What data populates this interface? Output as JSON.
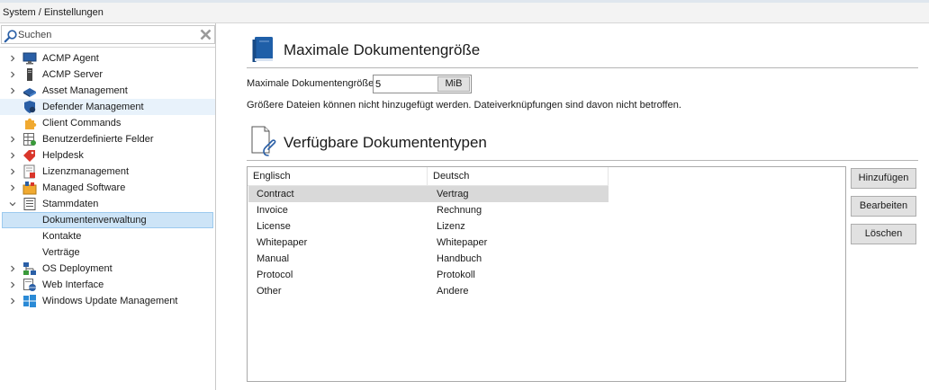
{
  "breadcrumb": "System / Einstellungen",
  "search": {
    "placeholder": "Suchen",
    "value": ""
  },
  "tree": [
    {
      "label": "ACMP Agent",
      "icon": "monitor-icon",
      "expander": "collapsed"
    },
    {
      "label": "ACMP Server",
      "icon": "server-icon",
      "expander": "collapsed"
    },
    {
      "label": "Asset Management",
      "icon": "asset-icon",
      "expander": "collapsed"
    },
    {
      "label": "Defender Management",
      "icon": "shield-icon",
      "expander": "none",
      "state": "hover"
    },
    {
      "label": "Client Commands",
      "icon": "puzzle-icon",
      "expander": "none"
    },
    {
      "label": "Benutzerdefinierte Felder",
      "icon": "grid-icon",
      "expander": "collapsed"
    },
    {
      "label": "Helpdesk",
      "icon": "tag-icon",
      "expander": "collapsed"
    },
    {
      "label": "Lizenzmanagement",
      "icon": "license-icon",
      "expander": "collapsed"
    },
    {
      "label": "Managed Software",
      "icon": "package-icon",
      "expander": "collapsed"
    },
    {
      "label": "Stammdaten",
      "icon": "list-icon",
      "expander": "expanded"
    },
    {
      "label": "Dokumentenverwaltung",
      "icon": "",
      "expander": "none",
      "state": "selected",
      "child": true
    },
    {
      "label": "Kontakte",
      "icon": "",
      "expander": "none",
      "child": true
    },
    {
      "label": "Verträge",
      "icon": "",
      "expander": "none",
      "child": true
    },
    {
      "label": "OS Deployment",
      "icon": "network-icon",
      "expander": "collapsed"
    },
    {
      "label": "Web Interface",
      "icon": "web-icon",
      "expander": "collapsed"
    },
    {
      "label": "Windows Update Management",
      "icon": "windows-icon",
      "expander": "collapsed"
    }
  ],
  "section_size": {
    "title": "Maximale Dokumentengröße",
    "field_label": "Maximale Dokumentengröße",
    "value": "5",
    "unit": "MiB",
    "info": "Größere Dateien können nicht hinzugefügt werden. Dateiverknüpfungen sind davon nicht betroffen."
  },
  "section_types": {
    "title": "Verfügbare Dokumententypen",
    "columns": [
      "Englisch",
      "Deutsch"
    ],
    "rows": [
      [
        "Contract",
        "Vertrag"
      ],
      [
        "Invoice",
        "Rechnung"
      ],
      [
        "License",
        "Lizenz"
      ],
      [
        "Whitepaper",
        "Whitepaper"
      ],
      [
        "Manual",
        "Handbuch"
      ],
      [
        "Protocol",
        "Protokoll"
      ],
      [
        "Other",
        "Andere"
      ]
    ],
    "selected_row": 0,
    "buttons": {
      "add": "Hinzufügen",
      "edit": "Bearbeiten",
      "delete": "Löschen"
    }
  },
  "colors": {
    "selection": "#cde4f7",
    "hover": "#e8f2fb",
    "accent": "#1f5fa8"
  }
}
